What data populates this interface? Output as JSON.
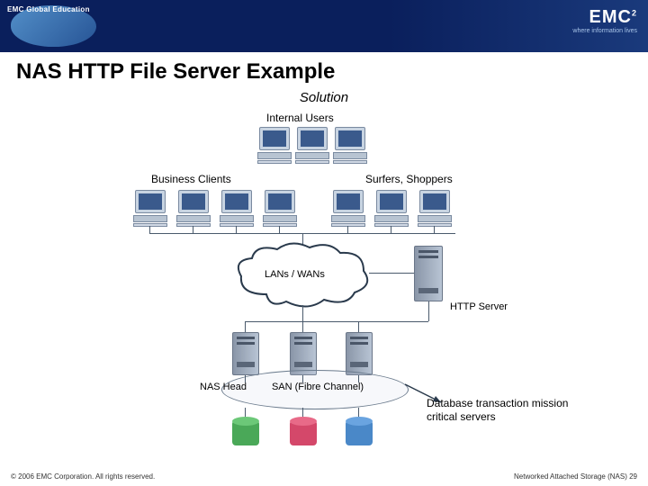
{
  "header": {
    "logo_left": "EMC Global Education",
    "logo_right_brand": "EMC",
    "logo_right_sup": "2",
    "logo_right_tag": "where information lives"
  },
  "title": "NAS HTTP File Server Example",
  "subtitle": "Solution",
  "labels": {
    "internal_users": "Internal Users",
    "business_clients": "Business Clients",
    "surfers_shoppers": "Surfers, Shoppers",
    "lans_wans": "LANs / WANs",
    "http_server": "HTTP Server",
    "nas_head": "NAS Head",
    "san": "SAN (Fibre Channel)",
    "db_caption": "Database transaction mission critical servers"
  },
  "footer": {
    "left": "© 2006 EMC Corporation. All rights reserved.",
    "right": "Networked Attached Storage (NAS) 29"
  },
  "colors": {
    "header_bg": "#0a1f5c",
    "accent": "#3a5a8c"
  }
}
